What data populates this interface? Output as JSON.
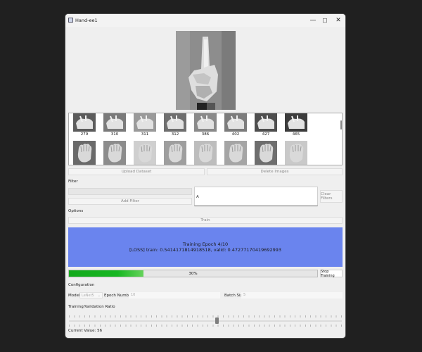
{
  "window": {
    "title": "Hand-ee1",
    "minimize_glyph": "—",
    "maximize_glyph": "☐",
    "close_glyph": "✕"
  },
  "gallery": {
    "row1_labels": [
      "279",
      "310",
      "311",
      "312",
      "386",
      "402",
      "427",
      "465"
    ]
  },
  "buttons": {
    "upload": "Upload Dataset",
    "delete": "Delete Images",
    "add_filter": "Add Filter",
    "clear_filters": "Clear Filters",
    "train": "Train",
    "stop_training": "Stop Training"
  },
  "filter": {
    "section_label": "Filter",
    "list_items": [
      "A"
    ]
  },
  "options": {
    "section_label": "Options"
  },
  "status": {
    "line1": "Training Epoch 4/10",
    "line2": "[LOSS] train: 0.5414171814918518, valid: 0.47277170419692993",
    "background": "#6a84ee"
  },
  "progress": {
    "text": "30%",
    "value": 0.3,
    "color": "#17b722"
  },
  "configuration": {
    "section_label": "Configuration",
    "model_label": "Model:",
    "model_value": "LeNet5",
    "epoch_label": "Epoch Number:",
    "epoch_value": "10",
    "batch_label": "Batch Size:",
    "batch_value": "5"
  },
  "ratio": {
    "label": "Training/Validation Ratio",
    "current_label": "Current Value: 56",
    "value": 56
  }
}
